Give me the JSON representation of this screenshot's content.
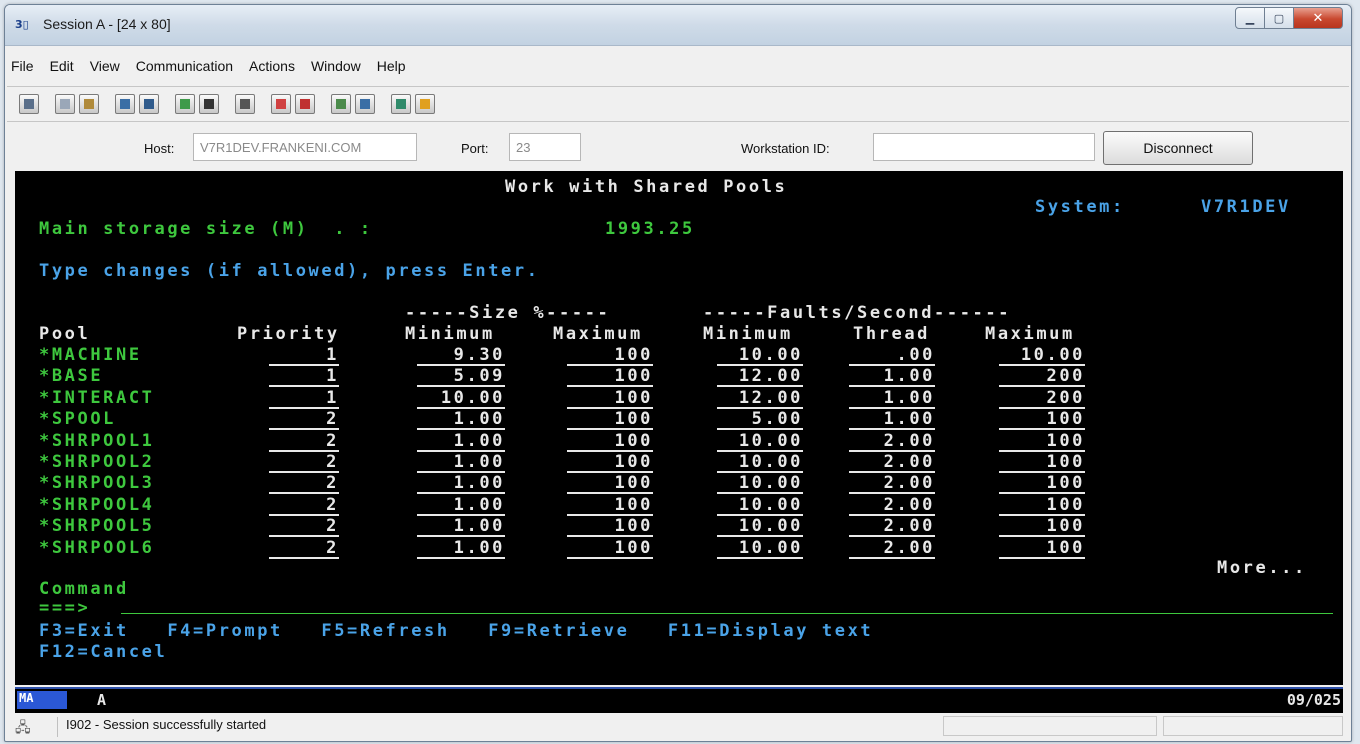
{
  "window": {
    "app_icon_text": "3▯",
    "title": "Session A - [24 x 80]",
    "minimize": "▁",
    "maximize": "▢",
    "close": "✕"
  },
  "menu": [
    {
      "label": "File"
    },
    {
      "label": "Edit"
    },
    {
      "label": "View"
    },
    {
      "label": "Communication"
    },
    {
      "label": "Actions"
    },
    {
      "label": "Window"
    },
    {
      "label": "Help"
    }
  ],
  "toolbar_icons": [
    {
      "name": "print-screen-icon",
      "color": "#5a6f8a"
    },
    {
      "name": "copy-icon",
      "color": "#9aa7b8"
    },
    {
      "name": "paste-icon",
      "color": "#b08a3a"
    },
    {
      "name": "send-file-icon",
      "color": "#3a6ea5"
    },
    {
      "name": "receive-file-icon",
      "color": "#2f5b8c"
    },
    {
      "name": "display-icon",
      "color": "#3f9a4a"
    },
    {
      "name": "keypad-icon",
      "color": "#333333"
    },
    {
      "name": "macro-icon",
      "color": "#555555"
    },
    {
      "name": "record-macro-icon",
      "color": "#d04040"
    },
    {
      "name": "stop-macro-icon",
      "color": "#c03030"
    },
    {
      "name": "play-macro-icon",
      "color": "#4a8a4a"
    },
    {
      "name": "network-icon",
      "color": "#3a6ea5"
    },
    {
      "name": "globe-icon",
      "color": "#2f8a6a"
    },
    {
      "name": "help-diamond-icon",
      "color": "#e0a020"
    }
  ],
  "connection": {
    "host_label": "Host:",
    "host_value": "V7R1DEV.FRANKENI.COM",
    "port_label": "Port:",
    "port_value": "23",
    "workstation_label": "Workstation ID:",
    "workstation_value": "",
    "disconnect_label": "Disconnect"
  },
  "screen": {
    "title": "Work with Shared Pools",
    "system_label": "System:",
    "system_value": "V7R1DEV",
    "main_storage_label": "Main storage size (M)  . :",
    "main_storage_value": "1993.25",
    "instruction": "Type changes (if allowed), press Enter.",
    "group_size": "-----Size %-----",
    "group_faults": "-----Faults/Second------",
    "headers": {
      "pool": "Pool",
      "priority": "Priority",
      "size_min": "Minimum",
      "size_max": "Maximum",
      "faults_min": "Minimum",
      "faults_thread": "Thread",
      "faults_max": "Maximum"
    },
    "rows": [
      {
        "pool": "*MACHINE",
        "priority": "1",
        "size_min": "9.30",
        "size_max": "100",
        "faults_min": "10.00",
        "faults_thread": ".00",
        "faults_max": "10.00"
      },
      {
        "pool": "*BASE",
        "priority": "1",
        "size_min": "5.09",
        "size_max": "100",
        "faults_min": "12.00",
        "faults_thread": "1.00",
        "faults_max": "200"
      },
      {
        "pool": "*INTERACT",
        "priority": "1",
        "size_min": "10.00",
        "size_max": "100",
        "faults_min": "12.00",
        "faults_thread": "1.00",
        "faults_max": "200"
      },
      {
        "pool": "*SPOOL",
        "priority": "2",
        "size_min": "1.00",
        "size_max": "100",
        "faults_min": "5.00",
        "faults_thread": "1.00",
        "faults_max": "100"
      },
      {
        "pool": "*SHRPOOL1",
        "priority": "2",
        "size_min": "1.00",
        "size_max": "100",
        "faults_min": "10.00",
        "faults_thread": "2.00",
        "faults_max": "100"
      },
      {
        "pool": "*SHRPOOL2",
        "priority": "2",
        "size_min": "1.00",
        "size_max": "100",
        "faults_min": "10.00",
        "faults_thread": "2.00",
        "faults_max": "100"
      },
      {
        "pool": "*SHRPOOL3",
        "priority": "2",
        "size_min": "1.00",
        "size_max": "100",
        "faults_min": "10.00",
        "faults_thread": "2.00",
        "faults_max": "100"
      },
      {
        "pool": "*SHRPOOL4",
        "priority": "2",
        "size_min": "1.00",
        "size_max": "100",
        "faults_min": "10.00",
        "faults_thread": "2.00",
        "faults_max": "100"
      },
      {
        "pool": "*SHRPOOL5",
        "priority": "2",
        "size_min": "1.00",
        "size_max": "100",
        "faults_min": "10.00",
        "faults_thread": "2.00",
        "faults_max": "100"
      },
      {
        "pool": "*SHRPOOL6",
        "priority": "2",
        "size_min": "1.00",
        "size_max": "100",
        "faults_min": "10.00",
        "faults_thread": "2.00",
        "faults_max": "100"
      }
    ],
    "more": "More...",
    "command_label": "Command",
    "command_prompt": "===>",
    "fkeys_line1": "F3=Exit   F4=Prompt   F5=Refresh   F9=Retrieve   F11=Display text",
    "fkeys_line2": "F12=Cancel"
  },
  "oia": {
    "ma": "MA",
    "mode": "A",
    "cursor_pos": "09/025"
  },
  "status": {
    "icon": "🖧",
    "message": "I902 - Session successfully started"
  }
}
